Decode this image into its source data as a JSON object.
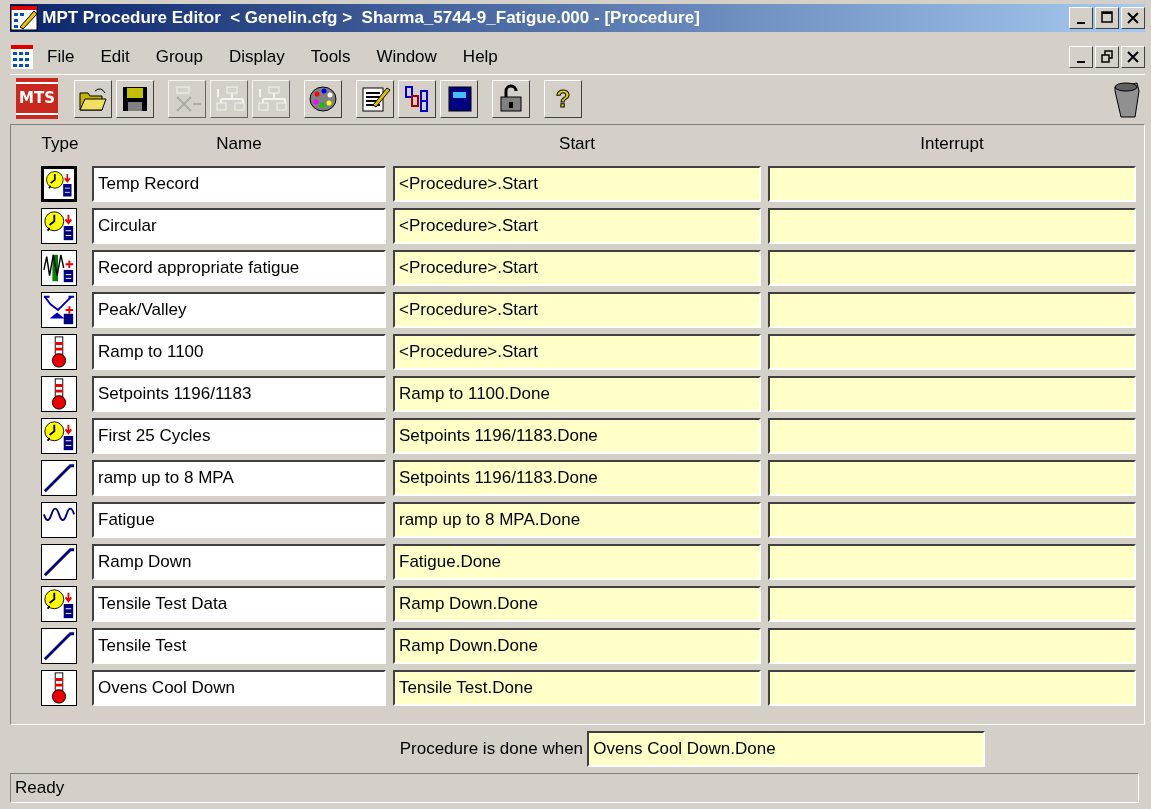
{
  "window": {
    "title": "MPT Procedure Editor  < Genelin.cfg >  Sharma_5744-9_Fatigue.000 - [Procedure]"
  },
  "menu": [
    "File",
    "Edit",
    "Group",
    "Display",
    "Tools",
    "Window",
    "Help"
  ],
  "toolbar": [
    {
      "kind": "logo",
      "label": "MTS",
      "disabled": false
    },
    {
      "kind": "open",
      "disabled": false
    },
    {
      "kind": "save",
      "disabled": false
    },
    {
      "kind": "delete",
      "disabled": true
    },
    {
      "kind": "group-down",
      "disabled": true
    },
    {
      "kind": "group-up",
      "disabled": true
    },
    {
      "kind": "palette",
      "disabled": false
    },
    {
      "kind": "edit",
      "disabled": false
    },
    {
      "kind": "chain",
      "disabled": false
    },
    {
      "kind": "book",
      "disabled": false
    },
    {
      "kind": "lock",
      "disabled": false
    },
    {
      "kind": "help",
      "label": "?",
      "disabled": false
    }
  ],
  "table": {
    "columns": [
      "Type",
      "Name",
      "Start",
      "Interrupt"
    ],
    "rows": [
      {
        "kind": "data",
        "selected": true,
        "name": "Temp Record",
        "start": "<Procedure>.Start"
      },
      {
        "kind": "data",
        "selected": false,
        "name": "Circular",
        "start": "<Procedure>.Start"
      },
      {
        "kind": "peak-data",
        "selected": false,
        "name": "Record appropriate fatigue",
        "start": "<Procedure>.Start"
      },
      {
        "kind": "peak-valley",
        "selected": false,
        "name": "Peak/Valley",
        "start": "<Procedure>.Start"
      },
      {
        "kind": "temperature",
        "selected": false,
        "name": "Ramp to 1100",
        "start": "<Procedure>.Start"
      },
      {
        "kind": "temperature",
        "selected": false,
        "name": "Setpoints 1196/1183",
        "start": "Ramp to 1100.Done"
      },
      {
        "kind": "data",
        "selected": false,
        "name": "First 25 Cycles",
        "start": "Setpoints 1196/1183.Done"
      },
      {
        "kind": "ramp",
        "selected": false,
        "name": "ramp up to 8 MPA",
        "start": "Setpoints 1196/1183.Done"
      },
      {
        "kind": "cyclic",
        "selected": false,
        "name": "Fatigue",
        "start": "ramp up to 8 MPA.Done"
      },
      {
        "kind": "ramp",
        "selected": false,
        "name": "Ramp Down",
        "start": "Fatigue.Done"
      },
      {
        "kind": "data",
        "selected": false,
        "name": "Tensile Test Data",
        "start": "Ramp Down.Done"
      },
      {
        "kind": "ramp",
        "selected": false,
        "name": "Tensile Test",
        "start": "Ramp Down.Done"
      },
      {
        "kind": "temperature",
        "selected": false,
        "name": "Ovens Cool Down",
        "start": "Tensile Test.Done"
      }
    ]
  },
  "done_when": {
    "label": "Procedure is done when",
    "value": "Ovens Cool Down.Done"
  },
  "status_bar": "Ready"
}
